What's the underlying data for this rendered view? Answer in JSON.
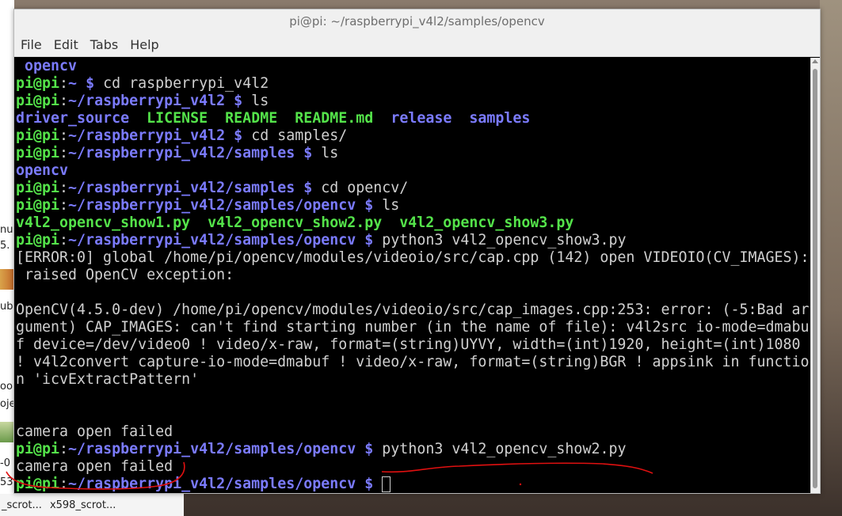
{
  "window": {
    "title": "pi@pi: ~/raspberrypi_v4l2/samples/opencv"
  },
  "menu": [
    "File",
    "Edit",
    "Tabs",
    "Help"
  ],
  "desktop": {
    "side_fragments": [
      "nu",
      "5.",
      "ub",
      "oo",
      "oje",
      "-0",
      "53"
    ],
    "bottom_labels": [
      "_scrot...",
      "x598_scrot..."
    ]
  },
  "terminal": {
    "lines": [
      [
        {
          "t": " opencv",
          "c": "b"
        }
      ],
      [
        {
          "t": "pi@pi",
          "c": "g"
        },
        {
          "t": ":",
          "c": "w"
        },
        {
          "t": "~",
          "c": "b"
        },
        {
          "t": " $ ",
          "c": "b"
        },
        {
          "t": "cd raspberrypi_v4l2",
          "c": "w"
        }
      ],
      [
        {
          "t": "pi@pi",
          "c": "g"
        },
        {
          "t": ":",
          "c": "w"
        },
        {
          "t": "~/raspberrypi_v4l2",
          "c": "b"
        },
        {
          "t": " $ ",
          "c": "b"
        },
        {
          "t": "ls",
          "c": "w"
        }
      ],
      [
        {
          "t": "driver_source",
          "c": "b"
        },
        {
          "t": "  ",
          "c": "w"
        },
        {
          "t": "LICENSE",
          "c": "g"
        },
        {
          "t": "  ",
          "c": "w"
        },
        {
          "t": "README",
          "c": "g"
        },
        {
          "t": "  ",
          "c": "w"
        },
        {
          "t": "README.md",
          "c": "g"
        },
        {
          "t": "  ",
          "c": "w"
        },
        {
          "t": "release",
          "c": "b"
        },
        {
          "t": "  ",
          "c": "w"
        },
        {
          "t": "samples",
          "c": "b"
        }
      ],
      [
        {
          "t": "pi@pi",
          "c": "g"
        },
        {
          "t": ":",
          "c": "w"
        },
        {
          "t": "~/raspberrypi_v4l2",
          "c": "b"
        },
        {
          "t": " $ ",
          "c": "b"
        },
        {
          "t": "cd samples/",
          "c": "w"
        }
      ],
      [
        {
          "t": "pi@pi",
          "c": "g"
        },
        {
          "t": ":",
          "c": "w"
        },
        {
          "t": "~/raspberrypi_v4l2/samples",
          "c": "b"
        },
        {
          "t": " $ ",
          "c": "b"
        },
        {
          "t": "ls",
          "c": "w"
        }
      ],
      [
        {
          "t": "opencv",
          "c": "b"
        }
      ],
      [
        {
          "t": "pi@pi",
          "c": "g"
        },
        {
          "t": ":",
          "c": "w"
        },
        {
          "t": "~/raspberrypi_v4l2/samples",
          "c": "b"
        },
        {
          "t": " $ ",
          "c": "b"
        },
        {
          "t": "cd opencv/",
          "c": "w"
        }
      ],
      [
        {
          "t": "pi@pi",
          "c": "g"
        },
        {
          "t": ":",
          "c": "w"
        },
        {
          "t": "~/raspberrypi_v4l2/samples/opencv",
          "c": "b"
        },
        {
          "t": " $ ",
          "c": "b"
        },
        {
          "t": "ls",
          "c": "w"
        }
      ],
      [
        {
          "t": "v4l2_opencv_show1.py",
          "c": "g"
        },
        {
          "t": "  ",
          "c": "w"
        },
        {
          "t": "v4l2_opencv_show2.py",
          "c": "g"
        },
        {
          "t": "  ",
          "c": "w"
        },
        {
          "t": "v4l2_opencv_show3.py",
          "c": "g"
        }
      ],
      [
        {
          "t": "pi@pi",
          "c": "g"
        },
        {
          "t": ":",
          "c": "w"
        },
        {
          "t": "~/raspberrypi_v4l2/samples/opencv",
          "c": "b"
        },
        {
          "t": " $ ",
          "c": "b"
        },
        {
          "t": "python3 v4l2_opencv_show3.py",
          "c": "w"
        }
      ],
      [
        {
          "t": "[ERROR:0] global /home/pi/opencv/modules/videoio/src/cap.cpp (142) open VIDEOIO(CV_IMAGES):",
          "c": "w"
        }
      ],
      [
        {
          "t": " raised OpenCV exception:",
          "c": "w"
        }
      ],
      [
        {
          "t": "",
          "c": "w"
        }
      ],
      [
        {
          "t": "OpenCV(4.5.0-dev) /home/pi/opencv/modules/videoio/src/cap_images.cpp:253: error: (-5:Bad ar",
          "c": "w"
        }
      ],
      [
        {
          "t": "gument) CAP_IMAGES: can't find starting number (in the name of file): v4l2src io-mode=dmabu",
          "c": "w"
        }
      ],
      [
        {
          "t": "f device=/dev/video0 ! video/x-raw, format=(string)UYVY, width=(int)1920, height=(int)1080",
          "c": "w"
        }
      ],
      [
        {
          "t": "! v4l2convert capture-io-mode=dmabuf ! video/x-raw, format=(string)BGR ! appsink in functio",
          "c": "w"
        }
      ],
      [
        {
          "t": "n 'icvExtractPattern'",
          "c": "w"
        }
      ],
      [
        {
          "t": "",
          "c": "w"
        }
      ],
      [
        {
          "t": "",
          "c": "w"
        }
      ],
      [
        {
          "t": "camera open failed",
          "c": "w"
        }
      ],
      [
        {
          "t": "pi@pi",
          "c": "g"
        },
        {
          "t": ":",
          "c": "w"
        },
        {
          "t": "~/raspberrypi_v4l2/samples/opencv",
          "c": "b"
        },
        {
          "t": " $ ",
          "c": "b"
        },
        {
          "t": "python3 v4l2_opencv_show2.py",
          "c": "w"
        }
      ],
      [
        {
          "t": "camera open failed",
          "c": "w"
        }
      ],
      [
        {
          "t": "pi@pi",
          "c": "g"
        },
        {
          "t": ":",
          "c": "w"
        },
        {
          "t": "~/raspberrypi_v4l2/samples/opencv",
          "c": "b"
        },
        {
          "t": " $ ",
          "c": "b"
        }
      ]
    ]
  },
  "colors": {
    "prompt_user": "#54e34a",
    "prompt_path": "#7b7bff",
    "text": "#d0d0d0",
    "annotation": "#e01010"
  }
}
